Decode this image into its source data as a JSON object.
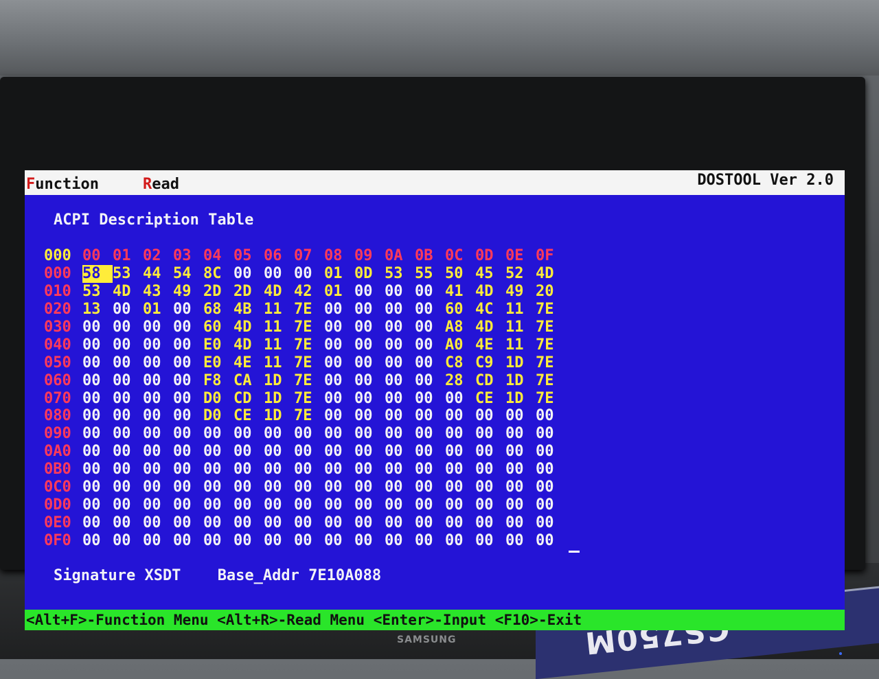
{
  "menubar": {
    "items": [
      {
        "hotkey": "F",
        "rest": "unction"
      },
      {
        "hotkey": "R",
        "rest": "ead"
      }
    ],
    "version": "DOSTOOL Ver 2.0"
  },
  "title": "ACPI Description Table",
  "table": {
    "corner": "000",
    "columns": [
      "00",
      "01",
      "02",
      "03",
      "04",
      "05",
      "06",
      "07",
      "08",
      "09",
      "0A",
      "0B",
      "0C",
      "0D",
      "0E",
      "0F"
    ],
    "rows": [
      {
        "addr": "000",
        "bytes": [
          "58",
          "53",
          "44",
          "54",
          "8C",
          "00",
          "00",
          "00",
          "01",
          "0D",
          "53",
          "55",
          "50",
          "45",
          "52",
          "4D"
        ]
      },
      {
        "addr": "010",
        "bytes": [
          "53",
          "4D",
          "43",
          "49",
          "2D",
          "2D",
          "4D",
          "42",
          "01",
          "00",
          "00",
          "00",
          "41",
          "4D",
          "49",
          "20"
        ]
      },
      {
        "addr": "020",
        "bytes": [
          "13",
          "00",
          "01",
          "00",
          "68",
          "4B",
          "11",
          "7E",
          "00",
          "00",
          "00",
          "00",
          "60",
          "4C",
          "11",
          "7E"
        ]
      },
      {
        "addr": "030",
        "bytes": [
          "00",
          "00",
          "00",
          "00",
          "60",
          "4D",
          "11",
          "7E",
          "00",
          "00",
          "00",
          "00",
          "A8",
          "4D",
          "11",
          "7E"
        ]
      },
      {
        "addr": "040",
        "bytes": [
          "00",
          "00",
          "00",
          "00",
          "E0",
          "4D",
          "11",
          "7E",
          "00",
          "00",
          "00",
          "00",
          "A0",
          "4E",
          "11",
          "7E"
        ]
      },
      {
        "addr": "050",
        "bytes": [
          "00",
          "00",
          "00",
          "00",
          "E0",
          "4E",
          "11",
          "7E",
          "00",
          "00",
          "00",
          "00",
          "C8",
          "C9",
          "1D",
          "7E"
        ]
      },
      {
        "addr": "060",
        "bytes": [
          "00",
          "00",
          "00",
          "00",
          "F8",
          "CA",
          "1D",
          "7E",
          "00",
          "00",
          "00",
          "00",
          "28",
          "CD",
          "1D",
          "7E"
        ]
      },
      {
        "addr": "070",
        "bytes": [
          "00",
          "00",
          "00",
          "00",
          "D0",
          "CD",
          "1D",
          "7E",
          "00",
          "00",
          "00",
          "00",
          "00",
          "CE",
          "1D",
          "7E"
        ]
      },
      {
        "addr": "080",
        "bytes": [
          "00",
          "00",
          "00",
          "00",
          "D0",
          "CE",
          "1D",
          "7E",
          "00",
          "00",
          "00",
          "00",
          "00",
          "00",
          "00",
          "00"
        ]
      },
      {
        "addr": "090",
        "bytes": [
          "00",
          "00",
          "00",
          "00",
          "00",
          "00",
          "00",
          "00",
          "00",
          "00",
          "00",
          "00",
          "00",
          "00",
          "00",
          "00"
        ]
      },
      {
        "addr": "0A0",
        "bytes": [
          "00",
          "00",
          "00",
          "00",
          "00",
          "00",
          "00",
          "00",
          "00",
          "00",
          "00",
          "00",
          "00",
          "00",
          "00",
          "00"
        ]
      },
      {
        "addr": "0B0",
        "bytes": [
          "00",
          "00",
          "00",
          "00",
          "00",
          "00",
          "00",
          "00",
          "00",
          "00",
          "00",
          "00",
          "00",
          "00",
          "00",
          "00"
        ]
      },
      {
        "addr": "0C0",
        "bytes": [
          "00",
          "00",
          "00",
          "00",
          "00",
          "00",
          "00",
          "00",
          "00",
          "00",
          "00",
          "00",
          "00",
          "00",
          "00",
          "00"
        ]
      },
      {
        "addr": "0D0",
        "bytes": [
          "00",
          "00",
          "00",
          "00",
          "00",
          "00",
          "00",
          "00",
          "00",
          "00",
          "00",
          "00",
          "00",
          "00",
          "00",
          "00"
        ]
      },
      {
        "addr": "0E0",
        "bytes": [
          "00",
          "00",
          "00",
          "00",
          "00",
          "00",
          "00",
          "00",
          "00",
          "00",
          "00",
          "00",
          "00",
          "00",
          "00",
          "00"
        ]
      },
      {
        "addr": "0F0",
        "bytes": [
          "00",
          "00",
          "00",
          "00",
          "00",
          "00",
          "00",
          "00",
          "00",
          "00",
          "00",
          "00",
          "00",
          "00",
          "00",
          "00"
        ]
      }
    ]
  },
  "info": {
    "signature": "Signature XSDT",
    "base_addr": "Base_Addr 7E10A088"
  },
  "statusbar": "<Alt+F>-Function Menu <Alt+R>-Read Menu <Enter>-Input <F10>-Exit",
  "monitor_brand": "SAMSUNG",
  "psu_label": "CS750M",
  "colors": {
    "screen_bg": "#2414d6",
    "address_red": "#ff3a5a",
    "highlight_yellow": "#ffec3a",
    "statusbar_green": "#2ae52a"
  }
}
